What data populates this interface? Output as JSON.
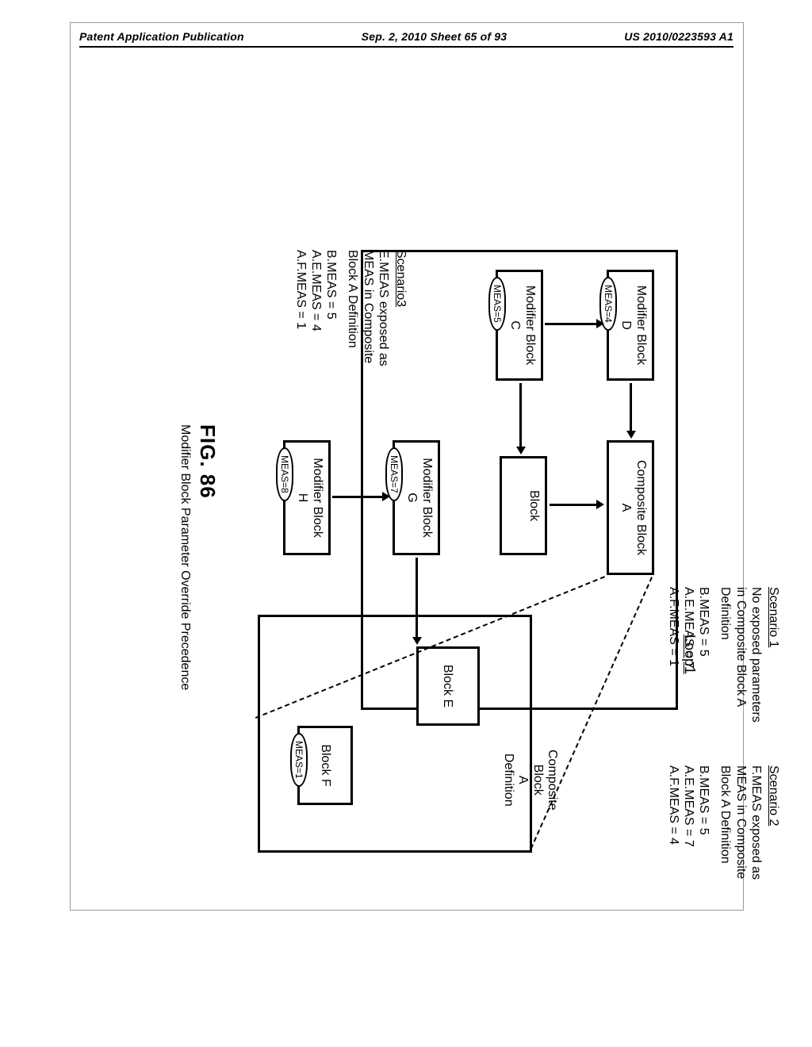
{
  "header": {
    "left": "Patent Application Publication",
    "center": "Sep. 2, 2010  Sheet 65 of 93",
    "right": "US 2010/0223593 A1"
  },
  "loop_label": "Loop1",
  "blocks": {
    "mod_d": {
      "label": "Modifier Block\nD",
      "meas": "MEAS=4"
    },
    "mod_c": {
      "label": "Modifier Block\nC",
      "meas": "MEAS=5"
    },
    "comp_a": {
      "label": "Composite Block\nA"
    },
    "plain": {
      "label": "Block"
    },
    "mod_g": {
      "label": "Modifier Block\nG",
      "meas": "MEAS=7"
    },
    "mod_h": {
      "label": "Modifier Block\nH",
      "meas": "MEAS=8"
    },
    "comp_def": {
      "label": "Composite Block\nA\nDefinition"
    },
    "block_e": {
      "label": "Block E"
    },
    "block_f": {
      "label": "Block F",
      "meas": "MEAS=1"
    }
  },
  "scenarios": {
    "s1": {
      "title": "Scenario 1",
      "desc": "No exposed parameters\nin Composite Block A\nDefinition",
      "vals": [
        "B.MEAS = 5",
        "A.E.MEAS = 7",
        "A.F.MEAS = 1"
      ]
    },
    "s2": {
      "title": "Scenario 2",
      "desc": "F.MEAS exposed as\nMEAS in Composite\nBlock A Definition",
      "vals": [
        "B.MEAS = 5",
        "A.E.MEAS = 7",
        "A.F.MEAS = 4"
      ]
    },
    "s3": {
      "title": "Scenario3",
      "desc": "E.MEAS exposed as\nMEAS in Composite\nBlock A Definition",
      "vals": [
        "B.MEAS = 5",
        "A.E.MEAS = 4",
        "A.F.MEAS = 1"
      ]
    }
  },
  "figure": {
    "num": "FIG. 86",
    "caption": "Modifier Block Parameter Override Precedence"
  }
}
